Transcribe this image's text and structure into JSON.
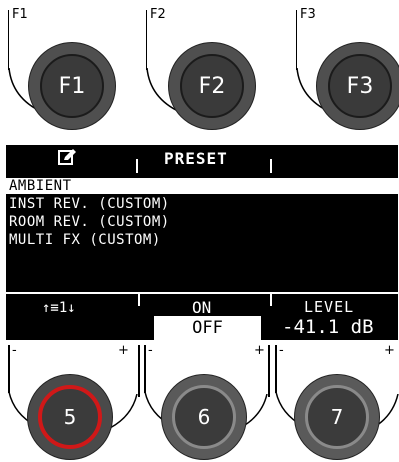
{
  "function_buttons": [
    {
      "label": "F1",
      "button_text": "F1"
    },
    {
      "label": "F2",
      "button_text": "F2"
    },
    {
      "label": "F3",
      "button_text": "F3"
    }
  ],
  "header": {
    "icon": "edit-icon",
    "title": "PRESET"
  },
  "preset_list": [
    {
      "text": "AMBIENT",
      "selected": true
    },
    {
      "text": "INST REV. (CUSTOM)",
      "selected": false
    },
    {
      "text": "ROOM REV. (CUSTOM)",
      "selected": false
    },
    {
      "text": "MULTI FX (CUSTOM)",
      "selected": false
    }
  ],
  "bottom_bar": {
    "scroll_label": "↑≡1↓",
    "on_label": "ON",
    "off_label": "OFF",
    "level_label": "LEVEL",
    "level_value": "-41.1 dB"
  },
  "dials": [
    {
      "number": "5",
      "minus": "-",
      "plus": "+",
      "active": true
    },
    {
      "number": "6",
      "minus": "-",
      "plus": "+",
      "active": false
    },
    {
      "number": "7",
      "minus": "-",
      "plus": "",
      "active": false
    }
  ],
  "colors": {
    "screen_bg": "#000000",
    "screen_fg": "#ffffff",
    "active_ring": "#d01818"
  }
}
